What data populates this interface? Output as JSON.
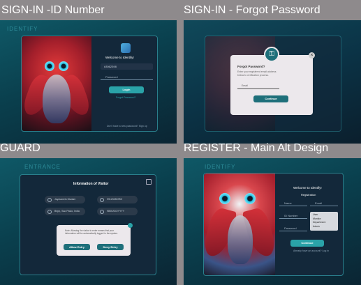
{
  "frames": {
    "id_number": {
      "title": "SIGN-IN -ID Number",
      "tag": "IDENTIFY",
      "welcome": "Welcome to IdentifyI",
      "id_value": "#3062398",
      "password_placeholder": "Password",
      "login_label": "Login",
      "forgot_link": "Forgot Password?",
      "register_text": "Don't have a new password? Sign up"
    },
    "forgot_password": {
      "title": "SIGN-IN - Forgot Password",
      "heading": "Forgot Password?",
      "description": "Enter your registered email address below to verification process.",
      "email_placeholder": "Email",
      "continue_label": "Continue",
      "close_icon": "close-icon",
      "key_icon": "key-icon"
    },
    "guard": {
      "title": "GUARD",
      "tag": "ENTRANCE",
      "heading": "Information of Visitor",
      "items": [
        {
          "label": "Jayavanelo Mudam"
        },
        {
          "label": "9912345678O"
        },
        {
          "label": "Bripp, Sao Paulo, India"
        },
        {
          "label": "98KK/DG/YYYY"
        }
      ],
      "modal_text": "Note: Allowing the visitor to enter means that your information will be automatically logged in the system.",
      "allow_label": "Allow Entry",
      "deny_label": "Deny Entry",
      "exit_icon": "exit-icon"
    },
    "register": {
      "title": "REGISTER - Main Alt Design",
      "tag": "IDENTIFY",
      "welcome": "Welcome to Identify!",
      "subtitle": "Registration",
      "name_placeholder": "Name",
      "email_placeholder": "Email",
      "id_placeholder": "ID Number",
      "password_placeholder": "Password",
      "role_options": [
        "User",
        "Monitor",
        "Department",
        "Admin"
      ],
      "continue_label": "Continue",
      "login_text": "Already have an account? Log in"
    }
  },
  "colors": {
    "accent": "#2aa3a8",
    "background": "#8e8a8c",
    "card": "#13283a"
  }
}
